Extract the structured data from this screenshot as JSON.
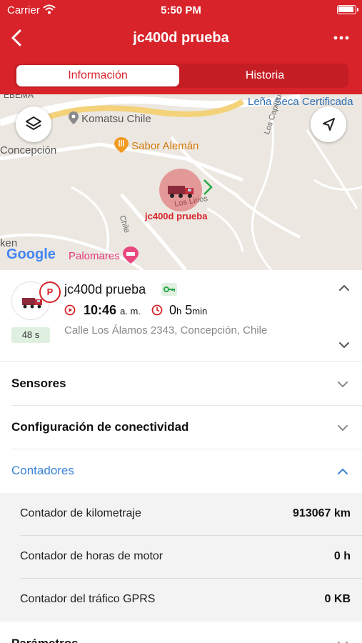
{
  "status_bar": {
    "carrier": "Carrier",
    "time": "5:50 PM"
  },
  "header": {
    "title": "jc400d prueba"
  },
  "tabs": [
    {
      "label": "Información",
      "active": true
    },
    {
      "label": "Historia",
      "active": false
    }
  ],
  "colors": {
    "brand": "#d8232a",
    "active_section": "#3b82d6",
    "age_badge": "#dff0e0"
  },
  "map": {
    "labels": {
      "komatsu": "Komatsu Chile",
      "sabor": "Sabor Alemán",
      "concepcion": "Concepción",
      "lena": "Leña Seca Certificada",
      "capilhues": "Los Capilhues",
      "chile_street": "Chile",
      "lirios": "Los Lirios",
      "palomares": "Palomares",
      "ken": "ken",
      "ebema": "EBEMA",
      "google": "Google"
    },
    "marker_label": "jc400d prueba"
  },
  "vehicle": {
    "name": "jc400d prueba",
    "parking_badge": "P",
    "time": "10:46",
    "time_suffix": "a. m.",
    "duration_h": "0",
    "duration_h_unit": "h",
    "duration_m": "5",
    "duration_m_unit": "min",
    "address": "Calle Los Álamos 2343, Concepción, Chile",
    "age": "48 s"
  },
  "sections": {
    "sensores": "Sensores",
    "conectividad": "Configuración de conectividad",
    "contadores": "Contadores",
    "parametros": "Parámetros"
  },
  "counters": [
    {
      "label": "Contador de kilometraje",
      "value": "913067 km"
    },
    {
      "label": "Contador de horas de motor",
      "value": "0 h"
    },
    {
      "label": "Contador del tráfico GPRS",
      "value": "0 KB"
    }
  ]
}
